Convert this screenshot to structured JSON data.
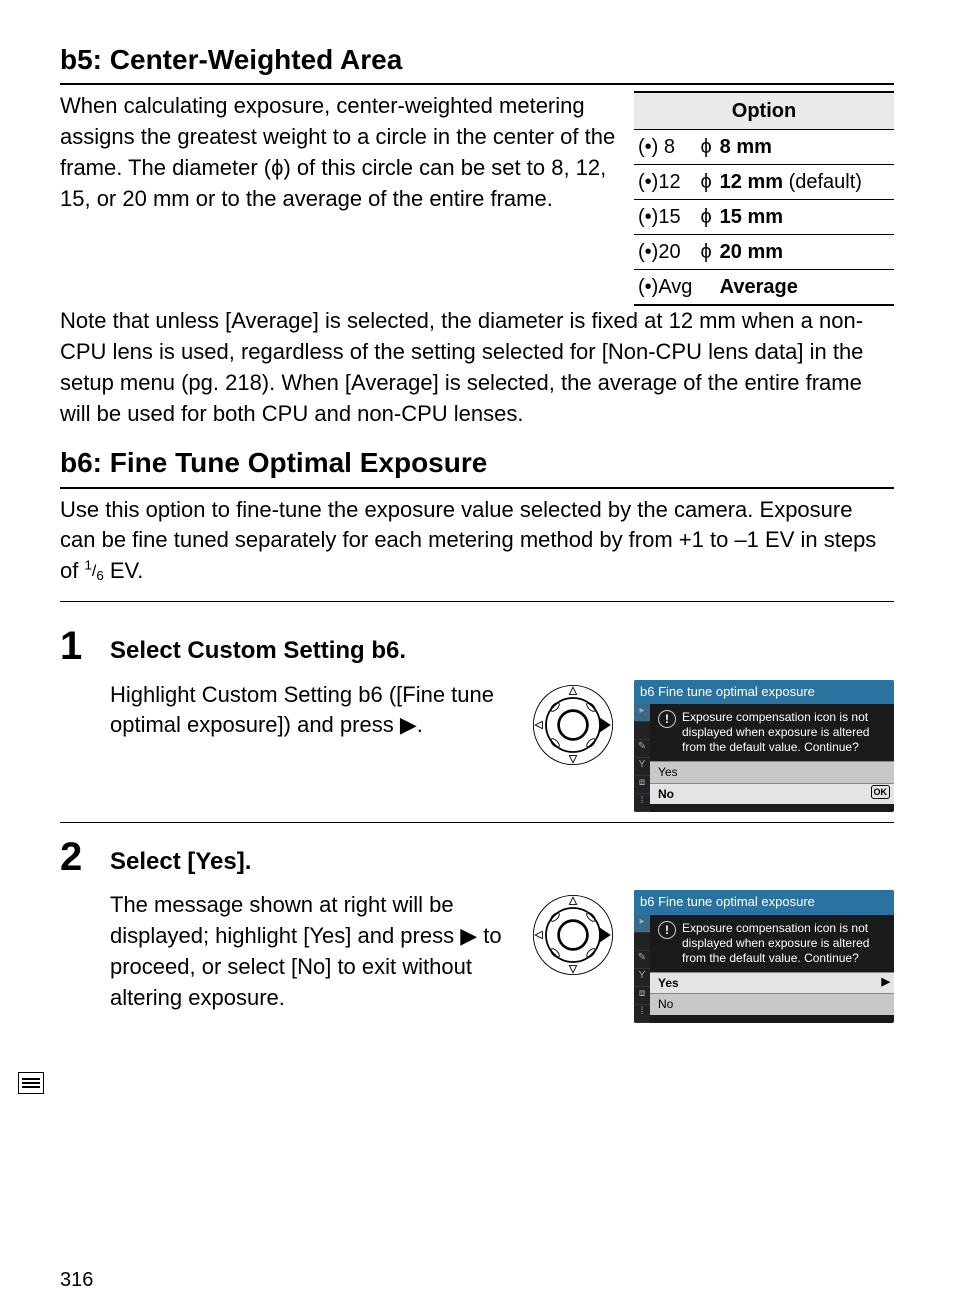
{
  "section_b5": {
    "heading": "b5: Center-Weighted Area",
    "intro": "When calculating exposure, center-weighted metering assigns the greatest weight to a circle in the center of the frame. The diameter (ϕ) of this circle can be set to 8, 12, 15, or 20 mm or to the average of the entire frame.",
    "note": "Note that unless [Average] is selected, the diameter is fixed at 12 mm when a non-CPU lens is used, regardless of the setting selected for [Non-CPU lens data] in the setup menu (pg. 218). When [Average] is selected, the average of the entire frame will be used for both CPU and non-CPU lenses.",
    "table": {
      "header": "Option",
      "rows": [
        {
          "icon": "(•) 8",
          "phi": "ϕ",
          "label": "8 mm",
          "suffix": ""
        },
        {
          "icon": "(•)12",
          "phi": "ϕ",
          "label": "12 mm",
          "suffix": " (default)"
        },
        {
          "icon": "(•)15",
          "phi": "ϕ",
          "label": "15 mm",
          "suffix": ""
        },
        {
          "icon": "(•)20",
          "phi": "ϕ",
          "label": "20 mm",
          "suffix": ""
        },
        {
          "icon": "(•)Avg",
          "phi": "",
          "label": "Average",
          "suffix": ""
        }
      ]
    }
  },
  "section_b6": {
    "heading": "b6: Fine Tune Optimal Exposure",
    "intro_prefix": "Use this option to fine-tune the exposure value selected by the camera.  Exposure can be fine tuned separately for each metering method by from +1 to –1 EV in steps of ",
    "intro_frac_num": "1",
    "intro_frac_den": "6",
    "intro_suffix": " EV.",
    "steps": [
      {
        "num": "1",
        "title": "Select Custom Setting b6.",
        "text": "Highlight Custom Setting b6 ([Fine tune optimal exposure]) and press ▶.",
        "lcd": {
          "title": "b6 Fine tune optimal exposure",
          "message": "Exposure compensation icon is not displayed when exposure is altered from the default value. Continue?",
          "opt1": "Yes",
          "opt2": "No",
          "ok_on": "opt2"
        }
      },
      {
        "num": "2",
        "title": "Select [Yes].",
        "text": "The message shown at right will be displayed; highlight [Yes] and press ▶  to proceed, or select [No] to exit without altering exposure.",
        "lcd": {
          "title": "b6 Fine tune optimal exposure",
          "message": "Exposure compensation icon is not displayed when exposure is altered from the default value. Continue?",
          "opt1": "Yes",
          "opt2": "No",
          "arrow_on": "opt1"
        }
      }
    ]
  },
  "page_number": "316"
}
